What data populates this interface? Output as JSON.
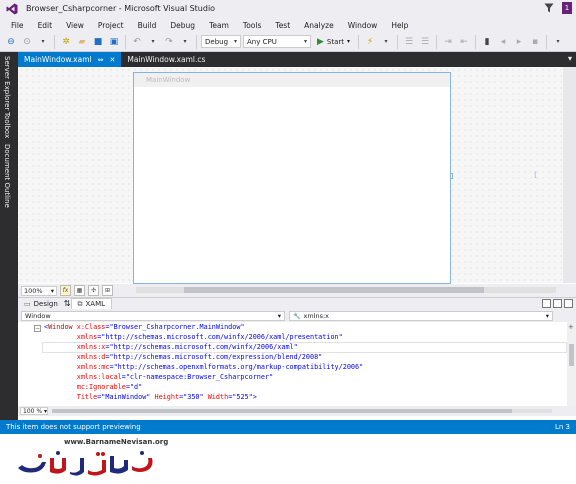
{
  "titlebar": {
    "title": "Browser_Csharpcorner - Microsoft Visual Studio",
    "notification_count": "1"
  },
  "menu": {
    "items": [
      "File",
      "Edit",
      "View",
      "Project",
      "Build",
      "Debug",
      "Team",
      "Tools",
      "Test",
      "Analyze",
      "Window",
      "Help"
    ]
  },
  "toolbar": {
    "config": "Debug",
    "platform": "Any CPU",
    "start_label": "Start"
  },
  "sidepanel": {
    "tabs": [
      "Server Explorer",
      "Toolbox",
      "Document Outline"
    ]
  },
  "tabs": [
    {
      "label": "MainWindow.xaml",
      "active": true
    },
    {
      "label": "MainWindow.xaml.cs",
      "active": false
    }
  ],
  "designer": {
    "window_title": "MainWindow",
    "zoom": "100%"
  },
  "split": {
    "design_label": "Design",
    "xaml_label": "XAML"
  },
  "nav": {
    "left": "Window",
    "right": "xmlns:x"
  },
  "code": {
    "lines": [
      [
        {
          "t": "<",
          "c": "punct"
        },
        {
          "t": "Window",
          "c": "tag"
        },
        {
          "t": " x:Class",
          "c": "attr"
        },
        {
          "t": "=",
          "c": "punct"
        },
        {
          "t": "\"Browser_Csharpcorner.MainWindow\"",
          "c": "val"
        }
      ],
      [
        {
          "t": "        xmlns",
          "c": "attr"
        },
        {
          "t": "=",
          "c": "punct"
        },
        {
          "t": "\"http://schemas.microsoft.com/winfx/2006/xaml/presentation\"",
          "c": "val"
        }
      ],
      [
        {
          "t": "        xmlns:x",
          "c": "attr"
        },
        {
          "t": "=",
          "c": "punct"
        },
        {
          "t": "\"http://schemas.microsoft.com/winfx/2006/xaml\"",
          "c": "val"
        }
      ],
      [
        {
          "t": "        xmlns:d",
          "c": "attr"
        },
        {
          "t": "=",
          "c": "punct"
        },
        {
          "t": "\"http://schemas.microsoft.com/expression/blend/2008\"",
          "c": "val"
        }
      ],
      [
        {
          "t": "        xmlns:mc",
          "c": "attr"
        },
        {
          "t": "=",
          "c": "punct"
        },
        {
          "t": "\"http://schemas.openxmlformats.org/markup-compatibility/2006\"",
          "c": "val"
        }
      ],
      [
        {
          "t": "        xmlns:local",
          "c": "attr"
        },
        {
          "t": "=",
          "c": "punct"
        },
        {
          "t": "\"clr-namespace:Browser_Csharpcorner\"",
          "c": "val"
        }
      ],
      [
        {
          "t": "        mc:Ignorable",
          "c": "attr"
        },
        {
          "t": "=",
          "c": "punct"
        },
        {
          "t": "\"d\"",
          "c": "val"
        }
      ],
      [
        {
          "t": "        Title",
          "c": "attr"
        },
        {
          "t": "=",
          "c": "punct"
        },
        {
          "t": "\"MainWindow\"",
          "c": "val"
        },
        {
          "t": " Height",
          "c": "attr"
        },
        {
          "t": "=",
          "c": "punct"
        },
        {
          "t": "\"350\"",
          "c": "val"
        },
        {
          "t": " Width",
          "c": "attr"
        },
        {
          "t": "=",
          "c": "punct"
        },
        {
          "t": "\"525\"",
          "c": "val"
        },
        {
          "t": ">",
          "c": "punct"
        }
      ]
    ]
  },
  "editor": {
    "zoom": "100 %"
  },
  "status": {
    "message": "This item does not support previewing",
    "line": "Ln 3"
  },
  "footer": {
    "url": "www.BarnameNevisan.org"
  },
  "colors": {
    "accent": "#007acc",
    "chrome": "#eeeef2",
    "dark_panel": "#2d2d30",
    "vs_purple": "#68217a"
  }
}
